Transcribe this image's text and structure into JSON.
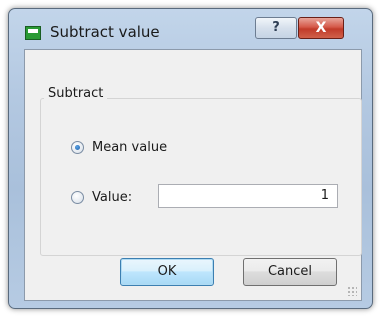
{
  "window": {
    "title": "Subtract value",
    "help_glyph": "?",
    "close_glyph": "X"
  },
  "group": {
    "label": "Subtract"
  },
  "options": {
    "mean_label": "Mean value",
    "mean_checked": true,
    "value_label": "Value:",
    "value_checked": false,
    "value_input": "1"
  },
  "buttons": {
    "ok_label": "OK",
    "cancel_label": "Cancel"
  },
  "colors": {
    "title_bar": "#b3c8e1",
    "close_button": "#c13b2a",
    "ok_button": "#bee6fd"
  },
  "icons": {
    "app": "app-window-icon",
    "resize": "resize-grip-icon"
  }
}
